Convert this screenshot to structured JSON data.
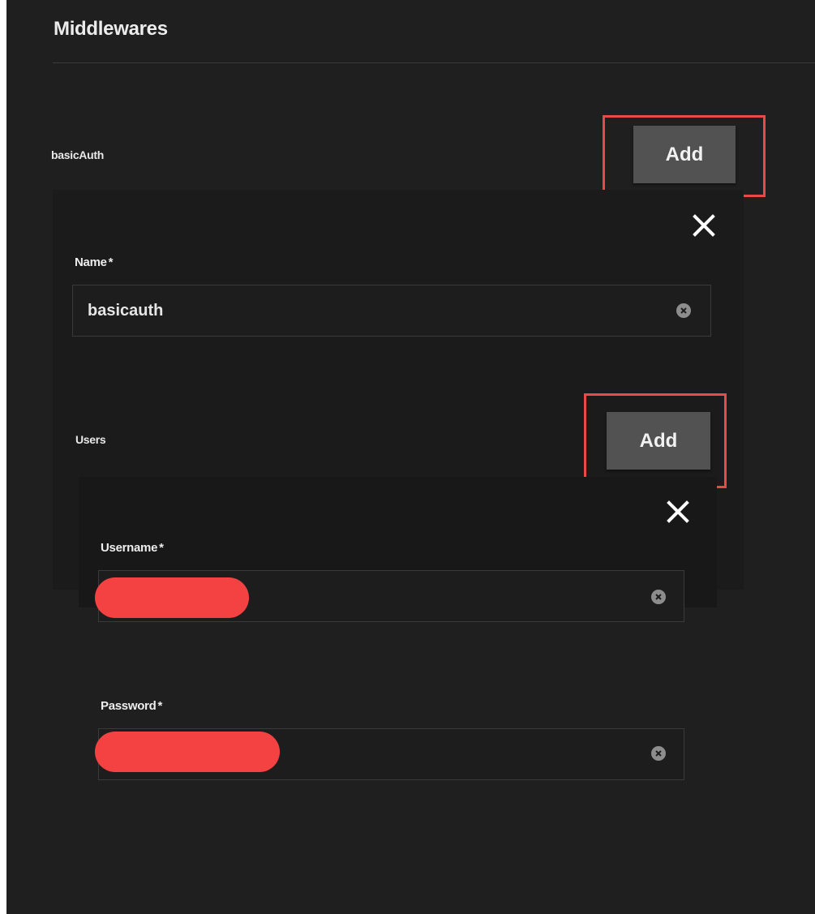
{
  "header": {
    "title": "Middlewares"
  },
  "basic_auth": {
    "label": "basicAuth",
    "add_label": "Add",
    "name_field": {
      "label": "Name",
      "required_mark": "*",
      "value": "basicauth"
    },
    "users": {
      "label": "Users",
      "add_label": "Add",
      "username_field": {
        "label": "Username",
        "required_mark": "*",
        "value": ""
      },
      "password_field": {
        "label": "Password",
        "required_mark": "*",
        "value": ""
      }
    }
  },
  "icons": {
    "remove": "close-icon",
    "clear": "clear-circle-icon"
  },
  "colors": {
    "background": "#1f1f1f",
    "button": "#525252",
    "highlight": "#e84a4a",
    "redaction": "#f44242"
  }
}
